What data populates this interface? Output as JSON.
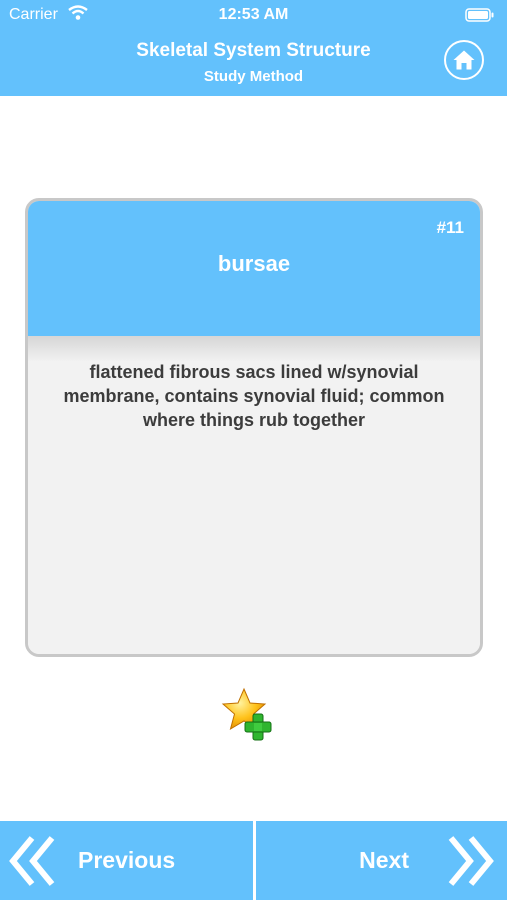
{
  "status_bar": {
    "carrier": "Carrier",
    "time": "12:53 AM",
    "wifi_icon": "wifi-icon",
    "battery_icon": "battery-icon"
  },
  "header": {
    "title": "Skeletal System Structure",
    "subtitle": "Study Method",
    "home_icon": "home-icon"
  },
  "card": {
    "number": "#11",
    "term": "bursae",
    "definition": "flattened fibrous sacs lined w/synovial membrane, contains synovial fluid; common where things rub together"
  },
  "favorite": {
    "icon": "star-add-icon"
  },
  "footer": {
    "previous_label": "Previous",
    "next_label": "Next",
    "previous_icon": "double-chevron-left-icon",
    "next_icon": "double-chevron-right-icon"
  },
  "colors": {
    "accent": "#63c1fc",
    "card_border": "#c8c8c8",
    "card_back": "#f2f2f2",
    "definition_text": "#3c3c3c"
  }
}
